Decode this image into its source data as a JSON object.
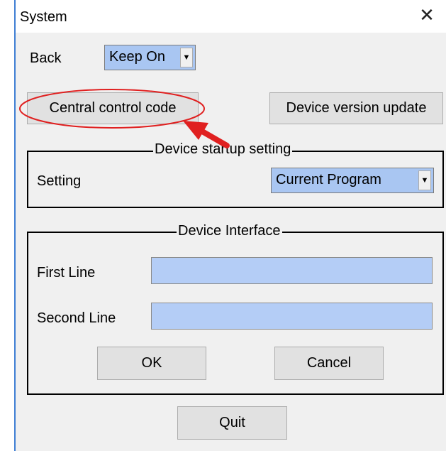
{
  "window": {
    "title": "System",
    "close_glyph": "✕"
  },
  "back": {
    "label": "Back",
    "selected": "Keep On",
    "arrow_glyph": "▼"
  },
  "buttons": {
    "central_control_code": "Central control code",
    "device_version_update": "Device version update",
    "ok": "OK",
    "cancel": "Cancel",
    "quit": "Quit"
  },
  "startup_group": {
    "title": "Device startup setting",
    "setting_label": "Setting",
    "setting_selected": "Current Program",
    "arrow_glyph": "▼"
  },
  "interface_group": {
    "title": "Device Interface",
    "first_line_label": "First Line",
    "first_line_value": "",
    "second_line_label": "Second Line",
    "second_line_value": ""
  },
  "annotation": {
    "highlight_color": "#e02020"
  }
}
